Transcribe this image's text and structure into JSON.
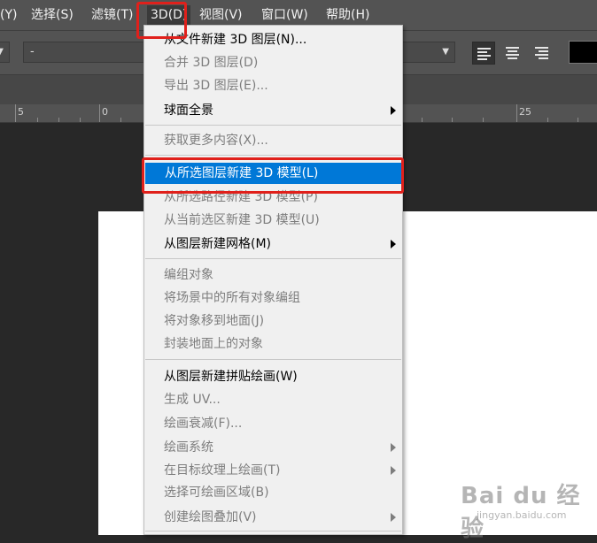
{
  "menubar": {
    "items": [
      "(Y)",
      "选择(S)",
      "滤镜(T)",
      "3D(D)",
      "视图(V)",
      "窗口(W)",
      "帮助(H)"
    ],
    "active": "3D(D)"
  },
  "options": {
    "font_style_value": "-"
  },
  "ruler": {
    "labels": [
      "5",
      "0",
      "25"
    ]
  },
  "menu": {
    "items": [
      {
        "label": "从文件新建 3D 图层(N)...",
        "enabled": true
      },
      {
        "label": "合并 3D 图层(D)",
        "enabled": false
      },
      {
        "label": "导出 3D 图层(E)...",
        "enabled": false
      },
      {
        "label": "球面全景",
        "enabled": true,
        "submenu": true
      },
      {
        "label": "获取更多内容(X)...",
        "enabled": false
      },
      {
        "label": "从所选图层新建 3D 模型(L)",
        "enabled": true,
        "highlighted": true
      },
      {
        "label": "从所选路径新建 3D 模型(P)",
        "enabled": false
      },
      {
        "label": "从当前选区新建 3D 模型(U)",
        "enabled": false
      },
      {
        "label": "从图层新建网格(M)",
        "enabled": true,
        "submenu": true
      },
      {
        "label": "编组对象",
        "enabled": false
      },
      {
        "label": "将场景中的所有对象编组",
        "enabled": false
      },
      {
        "label": "将对象移到地面(J)",
        "enabled": false
      },
      {
        "label": "封装地面上的对象",
        "enabled": false
      },
      {
        "label": "从图层新建拼贴绘画(W)",
        "enabled": true
      },
      {
        "label": "生成 UV...",
        "enabled": false
      },
      {
        "label": "绘画衰减(F)...",
        "enabled": false
      },
      {
        "label": "绘画系统",
        "enabled": false,
        "submenu": true
      },
      {
        "label": "在目标纹理上绘画(T)",
        "enabled": false,
        "submenu": true
      },
      {
        "label": "选择可绘画区域(B)",
        "enabled": false
      },
      {
        "label": "创建绘图叠加(V)",
        "enabled": false,
        "submenu": true
      }
    ]
  },
  "watermark": {
    "line1": "Bai du 经验",
    "line2": "jingyan.baidu.com"
  },
  "colors": {
    "highlight": "#0078d7",
    "annotation_red": "#e0201b",
    "menubar_bg": "#535353",
    "menu_bg": "#f0f0f0"
  }
}
